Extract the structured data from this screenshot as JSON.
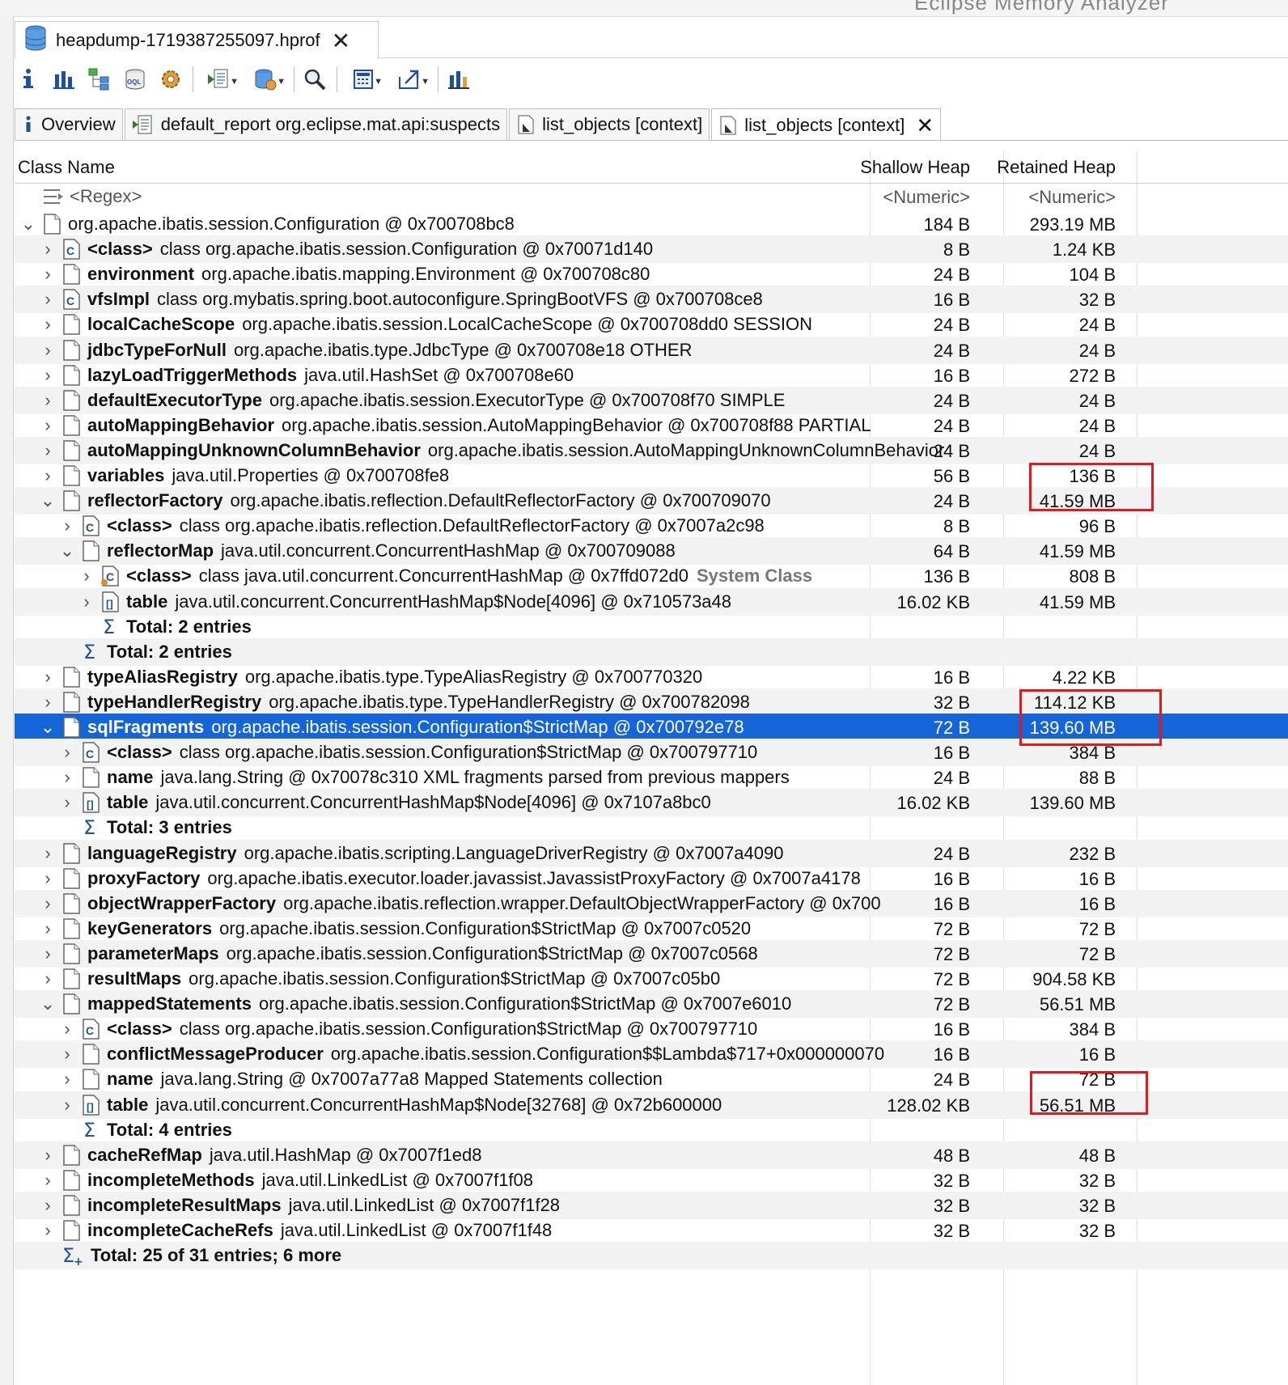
{
  "window": {
    "title_fragment": "Eclipse Memory Analyzer"
  },
  "file_tab": {
    "label": "heapdump-1719387255097.hprof"
  },
  "toolbar": {
    "buttons": [
      "info-icon",
      "histogram-icon",
      "dominator-tree-icon",
      "oql-icon",
      "thread-overview-icon",
      "run-report-icon",
      "query-browser-icon",
      "search-icon",
      "calculator-icon",
      "export-icon",
      "heap-dump-overview-icon"
    ]
  },
  "editor_tabs": [
    {
      "label": "Overview"
    },
    {
      "label": "default_report org.eclipse.mat.api:suspects"
    },
    {
      "label": "list_objects [context]"
    },
    {
      "label": "list_objects [context]"
    }
  ],
  "table": {
    "columns": {
      "name": "Class Name",
      "shallow": "Shallow Heap",
      "retained": "Retained Heap"
    },
    "filter": {
      "name": "<Regex>",
      "shallow": "<Numeric>",
      "retained": "<Numeric>"
    },
    "rows": [
      {
        "level": 0,
        "toggle": "down",
        "icon": "object",
        "field": "",
        "text": "org.apache.ibatis.session.Configuration @ 0x700708bc8",
        "shallow": "184 B",
        "retained": "293.19 MB"
      },
      {
        "level": 1,
        "toggle": "right",
        "icon": "class",
        "field": "<class>",
        "text": "class org.apache.ibatis.session.Configuration @ 0x70071d140",
        "shallow": "8 B",
        "retained": "1.24 KB"
      },
      {
        "level": 1,
        "toggle": "right",
        "icon": "object",
        "field": "environment",
        "text": "org.apache.ibatis.mapping.Environment @ 0x700708c80",
        "shallow": "24 B",
        "retained": "104 B"
      },
      {
        "level": 1,
        "toggle": "right",
        "icon": "class",
        "field": "vfsImpl",
        "text": "class org.mybatis.spring.boot.autoconfigure.SpringBootVFS @ 0x700708ce8",
        "shallow": "16 B",
        "retained": "32 B"
      },
      {
        "level": 1,
        "toggle": "right",
        "icon": "object",
        "field": "localCacheScope",
        "text": "org.apache.ibatis.session.LocalCacheScope @ 0x700708dd0  SESSION",
        "shallow": "24 B",
        "retained": "24 B"
      },
      {
        "level": 1,
        "toggle": "right",
        "icon": "object",
        "field": "jdbcTypeForNull",
        "text": "org.apache.ibatis.type.JdbcType @ 0x700708e18  OTHER",
        "shallow": "24 B",
        "retained": "24 B"
      },
      {
        "level": 1,
        "toggle": "right",
        "icon": "object",
        "field": "lazyLoadTriggerMethods",
        "text": "java.util.HashSet @ 0x700708e60",
        "shallow": "16 B",
        "retained": "272 B"
      },
      {
        "level": 1,
        "toggle": "right",
        "icon": "object",
        "field": "defaultExecutorType",
        "text": "org.apache.ibatis.session.ExecutorType @ 0x700708f70  SIMPLE",
        "shallow": "24 B",
        "retained": "24 B"
      },
      {
        "level": 1,
        "toggle": "right",
        "icon": "object",
        "field": "autoMappingBehavior",
        "text": "org.apache.ibatis.session.AutoMappingBehavior @ 0x700708f88  PARTIAL",
        "shallow": "24 B",
        "retained": "24 B"
      },
      {
        "level": 1,
        "toggle": "right",
        "icon": "object",
        "field": "autoMappingUnknownColumnBehavior",
        "text": "org.apache.ibatis.session.AutoMappingUnknownColumnBehavior",
        "shallow": "24 B",
        "retained": "24 B"
      },
      {
        "level": 1,
        "toggle": "right",
        "icon": "object",
        "field": "variables",
        "text": "java.util.Properties @ 0x700708fe8",
        "shallow": "56 B",
        "retained": "136 B"
      },
      {
        "level": 1,
        "toggle": "down",
        "icon": "object",
        "field": "reflectorFactory",
        "text": "org.apache.ibatis.reflection.DefaultReflectorFactory @ 0x700709070",
        "shallow": "24 B",
        "retained": "41.59 MB"
      },
      {
        "level": 2,
        "toggle": "right",
        "icon": "class",
        "field": "<class>",
        "text": "class org.apache.ibatis.reflection.DefaultReflectorFactory @ 0x7007a2c98",
        "shallow": "8 B",
        "retained": "96 B"
      },
      {
        "level": 2,
        "toggle": "down",
        "icon": "object",
        "field": "reflectorMap",
        "text": "java.util.concurrent.ConcurrentHashMap @ 0x700709088",
        "shallow": "64 B",
        "retained": "41.59 MB"
      },
      {
        "level": 3,
        "toggle": "right",
        "icon": "sysclass",
        "field": "<class>",
        "text": "class java.util.concurrent.ConcurrentHashMap @ 0x7ffd072d0",
        "suffix": "System Class",
        "shallow": "136 B",
        "retained": "808 B"
      },
      {
        "level": 3,
        "toggle": "right",
        "icon": "array",
        "field": "table",
        "text": "java.util.concurrent.ConcurrentHashMap$Node[4096] @ 0x710573a48",
        "shallow": "16.02 KB",
        "retained": "41.59 MB"
      },
      {
        "level": 3,
        "toggle": "none",
        "icon": "sigma",
        "field": "Total: 2 entries",
        "text": "",
        "shallow": "",
        "retained": ""
      },
      {
        "level": 2,
        "toggle": "none",
        "icon": "sigma",
        "field": "Total: 2 entries",
        "text": "",
        "shallow": "",
        "retained": ""
      },
      {
        "level": 1,
        "toggle": "right",
        "icon": "object",
        "field": "typeAliasRegistry",
        "text": "org.apache.ibatis.type.TypeAliasRegistry @ 0x700770320",
        "shallow": "16 B",
        "retained": "4.22 KB"
      },
      {
        "level": 1,
        "toggle": "right",
        "icon": "object",
        "field": "typeHandlerRegistry",
        "text": "org.apache.ibatis.type.TypeHandlerRegistry @ 0x700782098",
        "shallow": "32 B",
        "retained": "114.12 KB"
      },
      {
        "level": 1,
        "toggle": "down",
        "icon": "object",
        "field": "sqlFragments",
        "text": "org.apache.ibatis.session.Configuration$StrictMap @ 0x700792e78",
        "shallow": "72 B",
        "retained": "139.60 MB",
        "selected": true
      },
      {
        "level": 2,
        "toggle": "right",
        "icon": "class",
        "field": "<class>",
        "text": "class org.apache.ibatis.session.Configuration$StrictMap @ 0x700797710",
        "shallow": "16 B",
        "retained": "384 B"
      },
      {
        "level": 2,
        "toggle": "right",
        "icon": "object",
        "field": "name",
        "text": "java.lang.String @ 0x70078c310  XML fragments parsed from previous mappers",
        "shallow": "24 B",
        "retained": "88 B"
      },
      {
        "level": 2,
        "toggle": "right",
        "icon": "array",
        "field": "table",
        "text": "java.util.concurrent.ConcurrentHashMap$Node[4096] @ 0x7107a8bc0",
        "shallow": "16.02 KB",
        "retained": "139.60 MB"
      },
      {
        "level": 2,
        "toggle": "none",
        "icon": "sigma",
        "field": "Total: 3 entries",
        "text": "",
        "shallow": "",
        "retained": ""
      },
      {
        "level": 1,
        "toggle": "right",
        "icon": "object",
        "field": "languageRegistry",
        "text": "org.apache.ibatis.scripting.LanguageDriverRegistry @ 0x7007a4090",
        "shallow": "24 B",
        "retained": "232 B"
      },
      {
        "level": 1,
        "toggle": "right",
        "icon": "object",
        "field": "proxyFactory",
        "text": "org.apache.ibatis.executor.loader.javassist.JavassistProxyFactory @ 0x7007a4178",
        "shallow": "16 B",
        "retained": "16 B"
      },
      {
        "level": 1,
        "toggle": "right",
        "icon": "object",
        "field": "objectWrapperFactory",
        "text": "org.apache.ibatis.reflection.wrapper.DefaultObjectWrapperFactory @ 0x700",
        "shallow": "16 B",
        "retained": "16 B"
      },
      {
        "level": 1,
        "toggle": "right",
        "icon": "object",
        "field": "keyGenerators",
        "text": "org.apache.ibatis.session.Configuration$StrictMap @ 0x7007c0520",
        "shallow": "72 B",
        "retained": "72 B"
      },
      {
        "level": 1,
        "toggle": "right",
        "icon": "object",
        "field": "parameterMaps",
        "text": "org.apache.ibatis.session.Configuration$StrictMap @ 0x7007c0568",
        "shallow": "72 B",
        "retained": "72 B"
      },
      {
        "level": 1,
        "toggle": "right",
        "icon": "object",
        "field": "resultMaps",
        "text": "org.apache.ibatis.session.Configuration$StrictMap @ 0x7007c05b0",
        "shallow": "72 B",
        "retained": "904.58 KB"
      },
      {
        "level": 1,
        "toggle": "down",
        "icon": "object",
        "field": "mappedStatements",
        "text": "org.apache.ibatis.session.Configuration$StrictMap @ 0x7007e6010",
        "shallow": "72 B",
        "retained": "56.51 MB"
      },
      {
        "level": 2,
        "toggle": "right",
        "icon": "class",
        "field": "<class>",
        "text": "class org.apache.ibatis.session.Configuration$StrictMap @ 0x700797710",
        "shallow": "16 B",
        "retained": "384 B"
      },
      {
        "level": 2,
        "toggle": "right",
        "icon": "object",
        "field": "conflictMessageProducer",
        "text": "org.apache.ibatis.session.Configuration$$Lambda$717+0x000000070",
        "shallow": "16 B",
        "retained": "16 B"
      },
      {
        "level": 2,
        "toggle": "right",
        "icon": "object",
        "field": "name",
        "text": "java.lang.String @ 0x7007a77a8  Mapped Statements collection",
        "shallow": "24 B",
        "retained": "72 B"
      },
      {
        "level": 2,
        "toggle": "right",
        "icon": "array",
        "field": "table",
        "text": "java.util.concurrent.ConcurrentHashMap$Node[32768] @ 0x72b600000",
        "shallow": "128.02 KB",
        "retained": "56.51 MB"
      },
      {
        "level": 2,
        "toggle": "none",
        "icon": "sigma",
        "field": "Total: 4 entries",
        "text": "",
        "shallow": "",
        "retained": ""
      },
      {
        "level": 1,
        "toggle": "right",
        "icon": "object",
        "field": "cacheRefMap",
        "text": "java.util.HashMap @ 0x7007f1ed8",
        "shallow": "48 B",
        "retained": "48 B"
      },
      {
        "level": 1,
        "toggle": "right",
        "icon": "object",
        "field": "incompleteMethods",
        "text": "java.util.LinkedList @ 0x7007f1f08",
        "shallow": "32 B",
        "retained": "32 B"
      },
      {
        "level": 1,
        "toggle": "right",
        "icon": "object",
        "field": "incompleteResultMaps",
        "text": "java.util.LinkedList @ 0x7007f1f28",
        "shallow": "32 B",
        "retained": "32 B"
      },
      {
        "level": 1,
        "toggle": "right",
        "icon": "object",
        "field": "incompleteCacheRefs",
        "text": "java.util.LinkedList @ 0x7007f1f48",
        "shallow": "32 B",
        "retained": "32 B"
      },
      {
        "level": 1,
        "toggle": "none",
        "icon": "sigma-plus",
        "field": "Total: 25 of 31 entries; 6 more",
        "text": "",
        "shallow": "",
        "retained": ""
      }
    ]
  },
  "colors": {
    "selection": "#1565d8",
    "highlight_box": "#e51919"
  }
}
